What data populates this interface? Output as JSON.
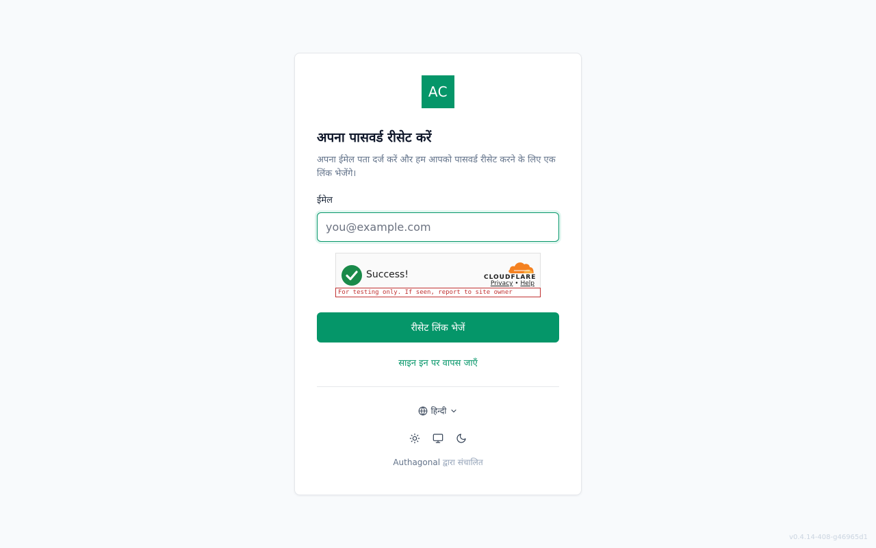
{
  "brand": {
    "logo_text": "AC",
    "logo_color": "#059669"
  },
  "form": {
    "title": "अपना पासवर्ड रीसेट करें",
    "subtitle": "अपना ईमेल पता दर्ज करें और हम आपको पासवर्ड रीसेट करने के लिए एक लिंक भेजेंगे।",
    "email_label": "ईमेल",
    "email_placeholder": "you@example.com",
    "email_value": "",
    "submit_label": "रीसेट लिंक भेजें",
    "back_link": "साइन इन पर वापस जाएँ"
  },
  "captcha": {
    "status": "Success!",
    "provider": "CLOUDFLARE",
    "privacy_link": "Privacy",
    "separator": "•",
    "help_link": "Help",
    "warning": "For testing only. If seen, report to site owner"
  },
  "footer": {
    "language": "हिन्दी",
    "powered_brand": "Authagonal",
    "powered_suffix": "द्वारा संचालित",
    "theme_icons": [
      "sun-icon",
      "monitor-icon",
      "moon-icon"
    ]
  },
  "version": "v0.4.14-408-g46965d1",
  "colors": {
    "accent": "#059669",
    "background": "#f8fafc",
    "captcha_success": "#1a8a4a",
    "cloudflare_orange": "#f48120",
    "warning_red": "#c03030"
  }
}
